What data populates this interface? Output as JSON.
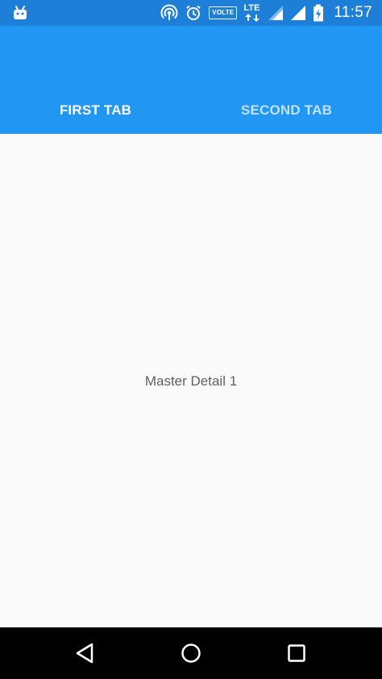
{
  "status_bar": {
    "time": "11:57",
    "volte_label": "VOLTE",
    "lte_label": "LTE",
    "icons": [
      "android-notification-icon",
      "hotspot-icon",
      "alarm-icon",
      "volte-badge",
      "lte-icon",
      "signal-icon",
      "signal-icon",
      "battery-charging-icon"
    ]
  },
  "tabs": [
    {
      "label": "FIRST TAB",
      "active": true
    },
    {
      "label": "SECOND TAB",
      "active": false
    }
  ],
  "content": {
    "detail_text": "Master Detail 1"
  },
  "nav_bar": {
    "buttons": [
      "back-icon",
      "home-icon",
      "recents-icon"
    ]
  },
  "colors": {
    "status_bar": "#1e7fd8",
    "app_bar": "#2196f3",
    "background": "#fafafa",
    "text": "#616161",
    "nav_bar": "#000000"
  }
}
